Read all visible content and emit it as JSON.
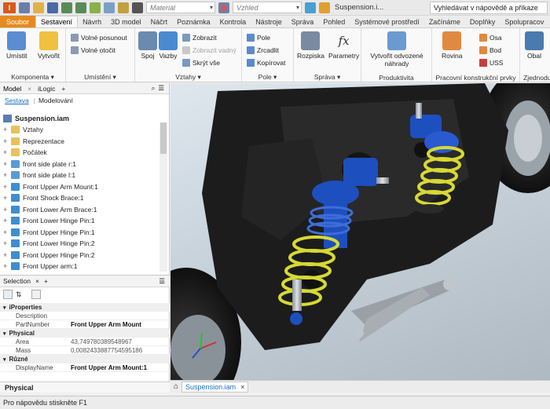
{
  "qat": {
    "material_placeholder": "Materiál",
    "appearance_placeholder": "Vzhled",
    "doc_title": "Suspension.i...",
    "help_search": "Vyhledávat v nápovědě a příkaze"
  },
  "tabs": [
    "Soubor",
    "Sestavení",
    "Návrh",
    "3D model",
    "Náčrt",
    "Poznámka",
    "Kontrola",
    "Nástroje",
    "Správa",
    "Pohled",
    "Systémové prostředí",
    "Začínáme",
    "Doplňky",
    "Spolupracov"
  ],
  "ribbon": {
    "komponenta": {
      "label": "Komponenta ▾",
      "umistit": "Umístit",
      "vytvorit": "Vytvořit"
    },
    "umisteni": {
      "label": "Umístění ▾",
      "volne_posunout": "Volné posunout",
      "volne_otocit": "Volné otočit"
    },
    "vztahy": {
      "label": "Vztahy ▾",
      "spoj": "Spoj",
      "vazby": "Vazby",
      "zobrazit": "Zobrazit",
      "zobrazit_vadny": "Zobrazit vadný",
      "skryt_vse": "Skrýt vše"
    },
    "pole": {
      "label": "Pole ▾",
      "pole": "Pole",
      "zrcadlit": "Zrcadlit",
      "kopirovat": "Kopírovat"
    },
    "sprava": {
      "label": "Správa ▾",
      "rozpiska": "Rozpiska",
      "parametry": "Parametry"
    },
    "produktivita": {
      "label": "Produktivita",
      "vytvorit_nahrady": "Vytvořit odvozené náhrady"
    },
    "pracovni": {
      "label": "Pracovní konstrukční prvky",
      "rovina": "Rovina",
      "osa": "Osa",
      "bod": "Bod",
      "uss": "USS"
    },
    "zjednodusit": {
      "label": "Zjednodu",
      "obal": "Obal"
    }
  },
  "browser": {
    "tabs": [
      "Model",
      "iLogic"
    ],
    "subtabs": [
      "Sestava",
      "Modelování"
    ],
    "root": "Suspension.iam",
    "items": [
      {
        "label": "Vztahy",
        "kind": "folder"
      },
      {
        "label": "Reprezentace",
        "kind": "folder"
      },
      {
        "label": "Počátek",
        "kind": "folder"
      },
      {
        "label": "front side plate r:1",
        "kind": "asm"
      },
      {
        "label": "front side plate l:1",
        "kind": "asm"
      },
      {
        "label": "Front Upper Arm Mount:1",
        "kind": "part"
      },
      {
        "label": "Front Shock Brace:1",
        "kind": "part"
      },
      {
        "label": "Front Lower Arm Brace:1",
        "kind": "part"
      },
      {
        "label": "Front Lower Hinge Pin:1",
        "kind": "part"
      },
      {
        "label": "Front Upper Hinge Pin:1",
        "kind": "part"
      },
      {
        "label": "Front Lower Hinge Pin:2",
        "kind": "part"
      },
      {
        "label": "Front Upper Hinge Pin:2",
        "kind": "part"
      },
      {
        "label": "Front Upper arm:1",
        "kind": "part"
      }
    ]
  },
  "selection": {
    "title": "Selection",
    "categories": [
      {
        "name": "iProperties",
        "rows": [
          {
            "key": "Description",
            "value": ""
          },
          {
            "key": "PartNumber",
            "value": "Front Upper Arm Mount"
          }
        ]
      },
      {
        "name": "Physical",
        "rows": [
          {
            "key": "Area",
            "value": "43,749780389548967"
          },
          {
            "key": "Mass",
            "value": "0,0082433887754595186"
          }
        ]
      },
      {
        "name": "Různé",
        "rows": [
          {
            "key": "DisplayName",
            "value": "Front Upper Arm Mount:1"
          }
        ]
      }
    ],
    "footer": "Physical"
  },
  "doc_tab": {
    "label": "Suspension.iam",
    "close": "×"
  },
  "status": "Pro nápovědu stiskněte F1",
  "colors": {
    "file_tab": "#e68a1f",
    "accent_link": "#1a6fc1",
    "spring": "#d7d934",
    "shock_blue": "#1d4fbf"
  }
}
